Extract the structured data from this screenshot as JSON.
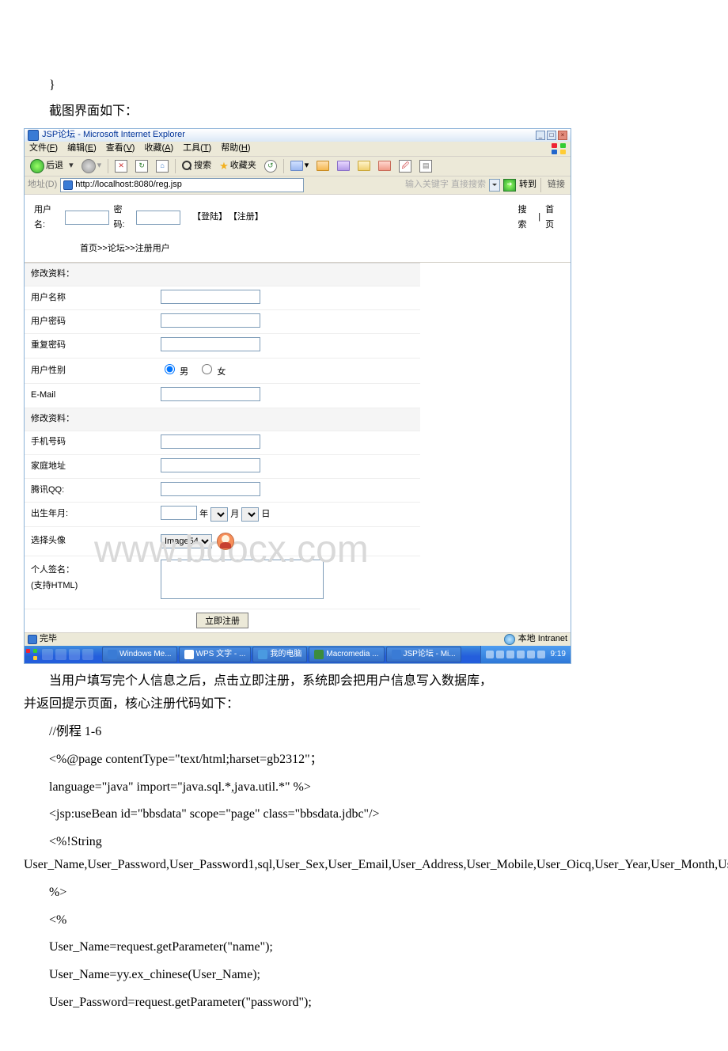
{
  "doc": {
    "brace": "}",
    "line1": "截图界面如下：",
    "after1": "当用户填写完个人信息之后，点击立即注册，系统即会把用户信息写入数据库，",
    "after2": "并返回提示页面，核心注册代码如下：",
    "code1": "//例程 1-6",
    "code2": "<%@page contentType=\"text/html;harset=gb2312\"；",
    "code3": "language=\"java\" import=\"java.sql.*,java.util.*\" %>",
    "code4": "<jsp:useBean id=\"bbsdata\" scope=\"page\" class=\"bbsdata.jdbc\"/>",
    "code5a": "<%!String",
    "code5b": "User_Name,User_Password,User_Password1,sql,User_Sex,User_Email,User_Address,User_Mobile,User_Oicq,User_Year,User_Month,User_Day,User_Birthday,User_Icon,User_Sign;",
    "code6": "%>",
    "code7": "<%",
    "code8": "User_Name=request.getParameter(\"name\");",
    "code9": "User_Name=yy.ex_chinese(User_Name);",
    "code10": "User_Password=request.getParameter(\"password\");"
  },
  "ie": {
    "title": "JSP论坛 - Microsoft Internet Explorer",
    "menu": {
      "file": "文件(",
      "f": "F",
      "file2": ")",
      "edit": "编辑(",
      "e": "E",
      "edit2": ")",
      "view": "查看(",
      "v": "V",
      "view2": ")",
      "fav": "收藏(",
      "a": "A",
      "fav2": ")",
      "tools": "工具(",
      "t": "T",
      "tools2": ")",
      "help": "帮助(",
      "h": "H",
      "help2": ")"
    },
    "toolbar": {
      "back": "后退",
      "search": "搜索",
      "fav": "收藏夹"
    },
    "addr": {
      "label": "地址(D)",
      "url": "http://localhost:8080/reg.jsp",
      "hint": "输入关键字 直接搜索",
      "go": "转到",
      "links": "链接"
    },
    "login": {
      "user": "用户名:",
      "pass": "密码:",
      "login": "【登陆】",
      "reg": "【注册】",
      "search": "搜索",
      "home": "首页"
    },
    "crumb": "首页>>论坛>>注册用户",
    "form": {
      "hdr1": "修改资料：",
      "name": "用户名称",
      "pass": "用户密码",
      "pass2": "重复密码",
      "sex": "用户性别",
      "male": "男",
      "female": "女",
      "email": "E-Mail",
      "hdr2": "修改资料：",
      "mobile": "手机号码",
      "addr": "家庭地址",
      "qq": "腾讯QQ:",
      "birth": "出生年月:",
      "year": "年",
      "month": "月",
      "day": "日",
      "avatar": "选择头像",
      "avatar_opt": "Image54",
      "sign1": "个人签名：",
      "sign2": "(支持HTML)",
      "submit": "立即注册"
    },
    "status": {
      "done": "完毕",
      "intranet": "本地 Intranet"
    },
    "taskbar": {
      "tasks": [
        {
          "label": "Windows Me..."
        },
        {
          "label": "WPS 文字 - ..."
        },
        {
          "label": "我的电脑"
        },
        {
          "label": "Macromedia ..."
        },
        {
          "label": "JSP论坛 - Mi..."
        }
      ],
      "time": "9:19"
    },
    "watermark": "www.bdocx.com"
  }
}
